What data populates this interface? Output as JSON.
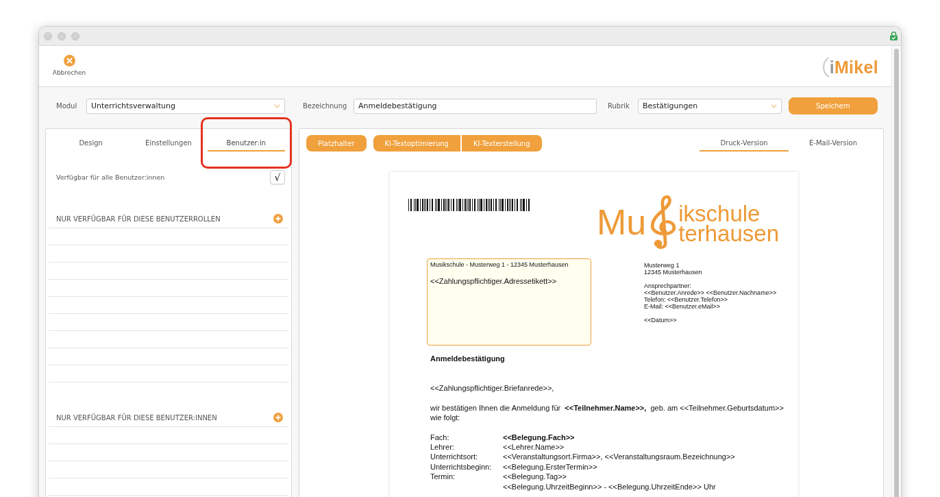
{
  "toolbar": {
    "cancel_button": "Abbrechen",
    "logo": {
      "mark": "i",
      "name": "Mikel"
    }
  },
  "form": {
    "fields": [
      {
        "kind": "select",
        "label": "Modul",
        "value": "Unterrichtsverwaltung"
      },
      {
        "kind": "text",
        "label": "Bezeichnung",
        "value": "Anmeldebestätigung"
      },
      {
        "kind": "select",
        "label": "Rubrik",
        "value": "Bestätigungen"
      }
    ],
    "save_button": "Speichern"
  },
  "left_panel": {
    "tabs": [
      {
        "label": "Design",
        "selected": false,
        "highlighted": false
      },
      {
        "label": "Einstellungen",
        "selected": false,
        "highlighted": false
      },
      {
        "label": "Benutzer:in",
        "selected": true,
        "highlighted": true
      }
    ],
    "all_users": {
      "label": "Verfügbar für alle Benutzer:innen",
      "checked": true,
      "tick": "√"
    },
    "sections": [
      {
        "title": "NUR VERFÜGBAR FÜR DIESE BENUTZERROLLEN"
      },
      {
        "title": "NUR VERFÜGBAR FÜR DIESE BENUTZER:INNEN"
      }
    ]
  },
  "right_panel": {
    "action_groups": [
      [
        "Platzhalter"
      ],
      [
        "KI-Textoptimierung",
        "KI-Texterstellung"
      ]
    ],
    "tabs": [
      {
        "label": "Druck-Version",
        "selected": true
      },
      {
        "label": "E-Mail-Version",
        "selected": false
      }
    ],
    "document": {
      "logo": {
        "lead": "Mu",
        "line_1": "ikschule",
        "line_2": "terhausen"
      },
      "address_window": {
        "return_address": "Musikschule - Musterweg 1 - 12345 Musterhausen",
        "recipient": "<<Zahlungspflichtiger.Adressetikett>>"
      },
      "sender_block": [
        [
          "Musterweg 1",
          "12345 Musterhausen"
        ],
        [
          "Ansprechpartner:",
          "<<Benutzer.Anrede>> <<Benutzer.Nachname>>",
          "Telefon: <<Benutzer.Telefon>>",
          "E-Mail: <<Benutzer.eMail>>"
        ],
        [
          "<<Datum>>"
        ]
      ],
      "subject": "Anmeldebestätigung",
      "salutation": "<<Zahlungspflichtiger.Briefanrede>>,",
      "intro": "wir bestätigen Ihnen die Anmeldung für  **<<Teilnehmer.Name>>,**  geb. am <<Teilnehmer.Geburtsdatum>> wie folgt:",
      "details": [
        {
          "label": "Fach:",
          "value": "<<Belegung.Fach>>",
          "bold": true
        },
        {
          "label": "Lehrer:",
          "value": "<<Lehrer.Name>>",
          "bold": false
        },
        {
          "label": "Unterrichtsort:",
          "value": "<<Veranstaltungsort.Firma>>, <<Veranstaltungsraum.Bezeichnung>>",
          "bold": false
        },
        {
          "label": "Unterrichtsbeginn:",
          "value": "<<Belegung.ErsterTermin>>",
          "bold": false
        },
        {
          "label": "Termin:",
          "value": "<<Belegung.Tag>>",
          "bold": false
        },
        {
          "value": "<<Belegung.UhrzeitBeginn>> - <<Belegung.UhrzeitEnde>> Uhr",
          "bold": false
        }
      ]
    }
  }
}
